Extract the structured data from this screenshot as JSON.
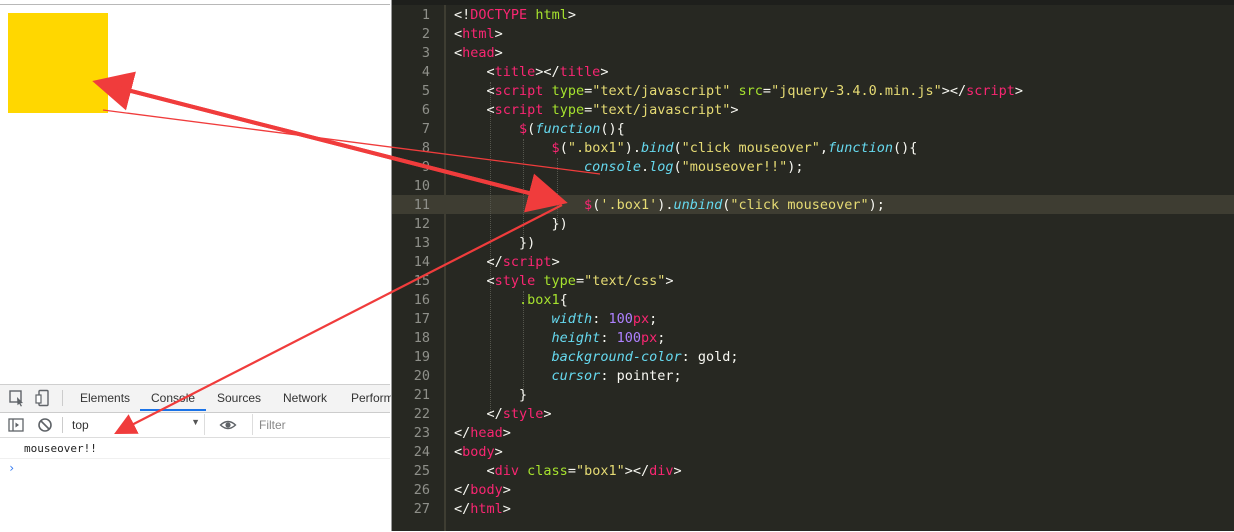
{
  "devtools": {
    "tabs": [
      {
        "label": "Elements"
      },
      {
        "label": "Console"
      },
      {
        "label": "Sources"
      },
      {
        "label": "Network"
      },
      {
        "label": "Perform"
      }
    ],
    "active_tab": "Console",
    "context": "top",
    "filter_placeholder": "Filter",
    "log": [
      "mouseover!!"
    ],
    "prompt_symbol": "›"
  },
  "colors": {
    "box": "#ffd700",
    "editor_bg": "#272822",
    "arrow": "#f03c3c",
    "active_tab_underline": "#1a73e8"
  },
  "editor": {
    "active_line": 11,
    "lines": [
      {
        "n": "1",
        "code": [
          [
            "p",
            "<!"
          ],
          [
            "t",
            "DOCTYPE"
          ],
          [
            "p",
            " "
          ],
          [
            "a",
            "html"
          ],
          [
            "p",
            ">"
          ]
        ]
      },
      {
        "n": "2",
        "code": [
          [
            "p",
            "<"
          ],
          [
            "t",
            "html"
          ],
          [
            "p",
            ">"
          ]
        ]
      },
      {
        "n": "3",
        "code": [
          [
            "p",
            "<"
          ],
          [
            "t",
            "head"
          ],
          [
            "p",
            ">"
          ]
        ]
      },
      {
        "n": "4",
        "code": [
          [
            "p",
            "    <"
          ],
          [
            "t",
            "title"
          ],
          [
            "p",
            "></"
          ],
          [
            "t",
            "title"
          ],
          [
            "p",
            ">"
          ]
        ]
      },
      {
        "n": "5",
        "code": [
          [
            "p",
            "    <"
          ],
          [
            "t",
            "script"
          ],
          [
            "p",
            " "
          ],
          [
            "a",
            "type"
          ],
          [
            "p",
            "="
          ],
          [
            "s",
            "\"text/javascript\""
          ],
          [
            "p",
            " "
          ],
          [
            "a",
            "src"
          ],
          [
            "p",
            "="
          ],
          [
            "s",
            "\"jquery-3.4.0.min.js\""
          ],
          [
            "p",
            "></"
          ],
          [
            "t",
            "script"
          ],
          [
            "p",
            ">"
          ]
        ]
      },
      {
        "n": "6",
        "code": [
          [
            "p",
            "    <"
          ],
          [
            "t",
            "script"
          ],
          [
            "p",
            " "
          ],
          [
            "a",
            "type"
          ],
          [
            "p",
            "="
          ],
          [
            "s",
            "\"text/javascript\""
          ],
          [
            "p",
            ">"
          ]
        ]
      },
      {
        "n": "7",
        "code": [
          [
            "p",
            "        "
          ],
          [
            "t",
            "$"
          ],
          [
            "p",
            "("
          ],
          [
            "f",
            "function"
          ],
          [
            "p",
            "(){"
          ]
        ]
      },
      {
        "n": "8",
        "code": [
          [
            "p",
            "            "
          ],
          [
            "t",
            "$"
          ],
          [
            "p",
            "("
          ],
          [
            "s",
            "\".box1\""
          ],
          [
            "p",
            ")."
          ],
          [
            "f",
            "bind"
          ],
          [
            "p",
            "("
          ],
          [
            "s",
            "\"click mouseover\""
          ],
          [
            "p",
            ","
          ],
          [
            "kw",
            "function"
          ],
          [
            "p",
            "(){"
          ]
        ]
      },
      {
        "n": "9",
        "code": [
          [
            "p",
            "                "
          ],
          [
            "kw",
            "console"
          ],
          [
            "p",
            "."
          ],
          [
            "f",
            "log"
          ],
          [
            "p",
            "("
          ],
          [
            "s",
            "\"mouseover!!\""
          ],
          [
            "p",
            ");"
          ]
        ]
      },
      {
        "n": "10",
        "code": []
      },
      {
        "n": "11",
        "code": [
          [
            "p",
            "                "
          ],
          [
            "t",
            "$"
          ],
          [
            "p",
            "("
          ],
          [
            "s",
            "'.box1'"
          ],
          [
            "p",
            ")."
          ],
          [
            "f",
            "unbind"
          ],
          [
            "p",
            "("
          ],
          [
            "s",
            "\"click mouseover\""
          ],
          [
            "p",
            ");"
          ]
        ]
      },
      {
        "n": "12",
        "code": [
          [
            "p",
            "            })"
          ]
        ]
      },
      {
        "n": "13",
        "code": [
          [
            "p",
            "        })"
          ]
        ]
      },
      {
        "n": "14",
        "code": [
          [
            "p",
            "    </"
          ],
          [
            "t",
            "script"
          ],
          [
            "p",
            ">"
          ]
        ]
      },
      {
        "n": "15",
        "code": [
          [
            "p",
            "    <"
          ],
          [
            "t",
            "style"
          ],
          [
            "p",
            " "
          ],
          [
            "a",
            "type"
          ],
          [
            "p",
            "="
          ],
          [
            "s",
            "\"text/css\""
          ],
          [
            "p",
            ">"
          ]
        ]
      },
      {
        "n": "16",
        "code": [
          [
            "p",
            "        "
          ],
          [
            "sel",
            ".box1"
          ],
          [
            "p",
            "{"
          ]
        ]
      },
      {
        "n": "17",
        "code": [
          [
            "p",
            "            "
          ],
          [
            "kw",
            "width"
          ],
          [
            "p",
            ": "
          ],
          [
            "n",
            "100"
          ],
          [
            "t",
            "px"
          ],
          [
            "p",
            ";"
          ]
        ]
      },
      {
        "n": "18",
        "code": [
          [
            "p",
            "            "
          ],
          [
            "kw",
            "height"
          ],
          [
            "p",
            ": "
          ],
          [
            "n",
            "100"
          ],
          [
            "t",
            "px"
          ],
          [
            "p",
            ";"
          ]
        ]
      },
      {
        "n": "19",
        "code": [
          [
            "p",
            "            "
          ],
          [
            "kw",
            "background-color"
          ],
          [
            "p",
            ": gold;"
          ]
        ]
      },
      {
        "n": "20",
        "code": [
          [
            "p",
            "            "
          ],
          [
            "kw",
            "cursor"
          ],
          [
            "p",
            ": pointer;"
          ]
        ]
      },
      {
        "n": "21",
        "code": [
          [
            "p",
            "        }"
          ]
        ]
      },
      {
        "n": "22",
        "code": [
          [
            "p",
            "    </"
          ],
          [
            "t",
            "style"
          ],
          [
            "p",
            ">"
          ]
        ]
      },
      {
        "n": "23",
        "code": [
          [
            "p",
            "</"
          ],
          [
            "t",
            "head"
          ],
          [
            "p",
            ">"
          ]
        ]
      },
      {
        "n": "24",
        "code": [
          [
            "p",
            "<"
          ],
          [
            "t",
            "body"
          ],
          [
            "p",
            ">"
          ]
        ]
      },
      {
        "n": "25",
        "code": [
          [
            "p",
            "    <"
          ],
          [
            "t",
            "div"
          ],
          [
            "p",
            " "
          ],
          [
            "a",
            "class"
          ],
          [
            "p",
            "="
          ],
          [
            "s",
            "\"box1\""
          ],
          [
            "p",
            "></"
          ],
          [
            "t",
            "div"
          ],
          [
            "p",
            ">"
          ]
        ]
      },
      {
        "n": "26",
        "code": [
          [
            "p",
            "</"
          ],
          [
            "t",
            "body"
          ],
          [
            "p",
            ">"
          ]
        ]
      },
      {
        "n": "27",
        "code": [
          [
            "p",
            "</"
          ],
          [
            "t",
            "html"
          ],
          [
            "p",
            ">"
          ]
        ]
      }
    ]
  }
}
